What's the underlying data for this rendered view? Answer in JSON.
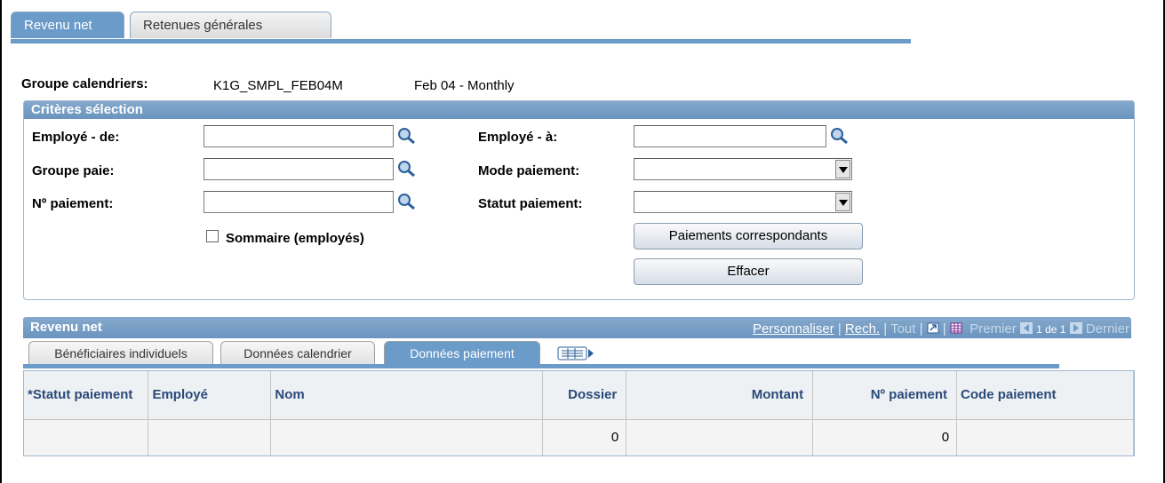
{
  "tabs": [
    {
      "label": "Revenu net",
      "active": true
    },
    {
      "label": "Retenues générales",
      "active": false
    }
  ],
  "calendar_group": {
    "label": "Groupe calendriers:",
    "id": "K1G_SMPL_FEB04M",
    "description": "Feb 04 - Monthly"
  },
  "criteria": {
    "title": "Critères sélection",
    "employee_from_label": "Employé - de:",
    "employee_from_value": "",
    "employee_to_label": "Employé - à:",
    "employee_to_value": "",
    "paygroup_label": "Groupe paie:",
    "paygroup_value": "",
    "pay_mode_label": "Mode paiement:",
    "pay_mode_value": "",
    "payment_no_label": "Nº paiement:",
    "payment_no_value": "",
    "pay_status_label": "Statut paiement:",
    "pay_status_value": "",
    "summary_label": "Sommaire (employés)",
    "summary_checked": false,
    "matching_button": "Paiements correspondants",
    "clear_button": "Effacer"
  },
  "grid": {
    "title": "Revenu net",
    "customize": "Personnaliser",
    "find": "Rech.",
    "view_all": "Tout",
    "first": "Premier",
    "range": "1 de 1",
    "last": "Dernier",
    "tabs": [
      {
        "label": "Bénéficiaires individuels",
        "active": false
      },
      {
        "label": "Données calendrier",
        "active": false
      },
      {
        "label": "Données paiement",
        "active": true
      }
    ],
    "columns": {
      "status": "*Statut paiement",
      "employee": "Employé",
      "name": "Nom",
      "record": "Dossier",
      "amount": "Montant",
      "payment_no": "Nº paiement",
      "payment_code": "Code paiement"
    },
    "rows": [
      {
        "status": "",
        "employee": "",
        "name": "",
        "record": "0",
        "amount": "",
        "payment_no": "0",
        "payment_code": ""
      }
    ]
  },
  "icons": {
    "lookup": "magnifier-icon",
    "dropdown": "chevron-down-icon",
    "zoom": "new-window-icon",
    "download": "grid-icon",
    "show_all_columns": "show-all-columns-icon"
  },
  "colors": {
    "accent": "#6b9bc9",
    "header_text": "#2a4a78"
  }
}
